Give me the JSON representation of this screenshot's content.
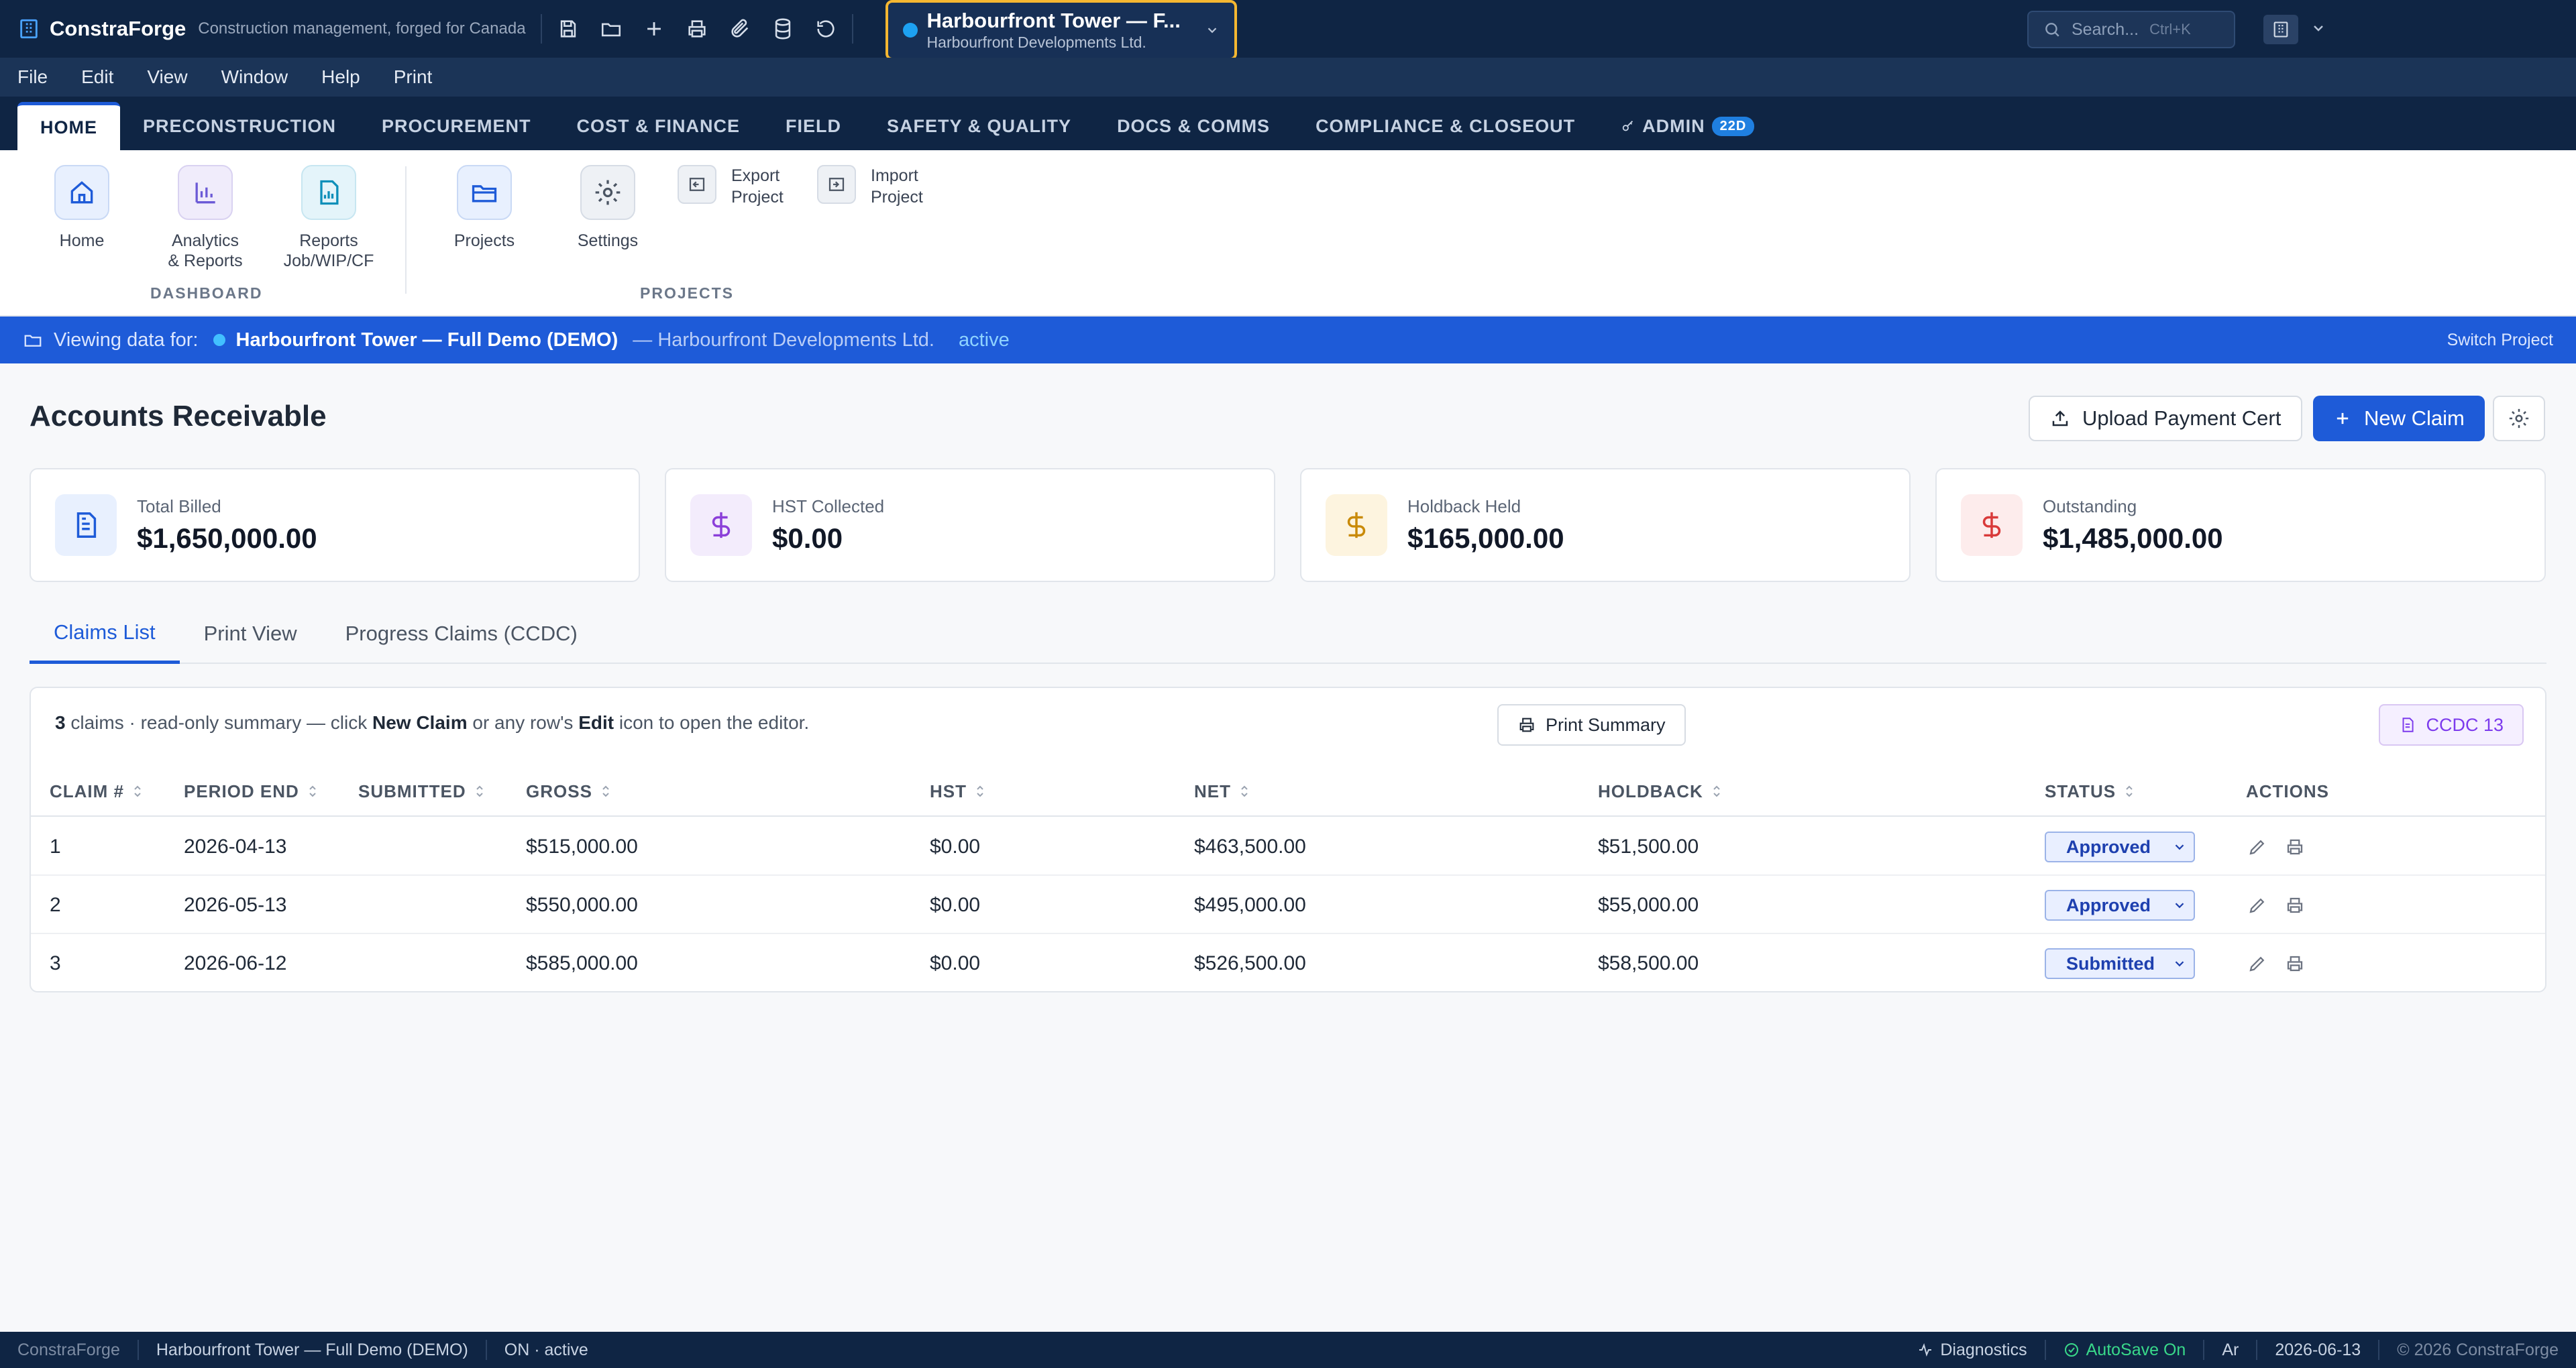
{
  "app": {
    "name": "ConstraForge",
    "tagline": "Construction management, forged for Canada"
  },
  "project_selector": {
    "title": "Harbourfront Tower — F...",
    "client": "Harbourfront Developments Ltd."
  },
  "search": {
    "placeholder": "Search...",
    "shortcut": "Ctrl+K"
  },
  "menu": [
    "File",
    "Edit",
    "View",
    "Window",
    "Help",
    "Print"
  ],
  "ribbon_tabs": [
    {
      "label": "HOME"
    },
    {
      "label": "PRECONSTRUCTION"
    },
    {
      "label": "PROCUREMENT"
    },
    {
      "label": "COST & FINANCE"
    },
    {
      "label": "FIELD"
    },
    {
      "label": "SAFETY & QUALITY"
    },
    {
      "label": "DOCS & COMMS"
    },
    {
      "label": "COMPLIANCE & CLOSEOUT"
    },
    {
      "label": "ADMIN",
      "badge": "22D"
    }
  ],
  "ribbon": {
    "dashboard_label": "DASHBOARD",
    "projects_label": "PROJECTS",
    "home": "Home",
    "analytics_1": "Analytics",
    "analytics_2": "& Reports",
    "reports_1": "Reports",
    "reports_2": "Job/WIP/CF",
    "projects": "Projects",
    "settings": "Settings",
    "export_1": "Export",
    "export_2": "Project",
    "import_1": "Import",
    "import_2": "Project"
  },
  "banner": {
    "prefix": "Viewing data for:",
    "project": "Harbourfront Tower — Full Demo (DEMO)",
    "client": "— Harbourfront Developments Ltd.",
    "status": "active",
    "switch": "Switch Project"
  },
  "page": {
    "title": "Accounts Receivable",
    "upload_label": "Upload Payment Cert",
    "new_claim_label": "New Claim"
  },
  "kpis": [
    {
      "label": "Total Billed",
      "value": "$1,650,000.00",
      "color": "#1e5bd8"
    },
    {
      "label": "HST Collected",
      "value": "$0.00",
      "color": "#8b3fd9"
    },
    {
      "label": "Holdback Held",
      "value": "$165,000.00",
      "color": "#c98a08"
    },
    {
      "label": "Outstanding",
      "value": "$1,485,000.00",
      "color": "#d93a3a"
    }
  ],
  "tabs": [
    {
      "label": "Claims List",
      "active": true
    },
    {
      "label": "Print View",
      "active": false
    },
    {
      "label": "Progress Claims (CCDC)",
      "active": false
    }
  ],
  "summary": {
    "count": "3",
    "text_1": " claims · read-only summary — click ",
    "new_claim": "New Claim",
    "text_2": " or any row's ",
    "edit": "Edit",
    "text_3": " icon to open the editor."
  },
  "print_summary_label": "Print Summary",
  "ccdc_label": "CCDC 13",
  "table": {
    "headers": [
      "CLAIM #",
      "PERIOD END",
      "SUBMITTED",
      "GROSS",
      "HST",
      "NET",
      "HOLDBACK",
      "STATUS",
      "ACTIONS"
    ],
    "rows": [
      {
        "claim": "1",
        "period_end": "2026-04-13",
        "submitted": "",
        "gross": "$515,000.00",
        "hst": "$0.00",
        "net": "$463,500.00",
        "holdback": "$51,500.00",
        "status": "Approved"
      },
      {
        "claim": "2",
        "period_end": "2026-05-13",
        "submitted": "",
        "gross": "$550,000.00",
        "hst": "$0.00",
        "net": "$495,000.00",
        "holdback": "$55,000.00",
        "status": "Approved"
      },
      {
        "claim": "3",
        "period_end": "2026-06-12",
        "submitted": "",
        "gross": "$585,000.00",
        "hst": "$0.00",
        "net": "$526,500.00",
        "holdback": "$58,500.00",
        "status": "Submitted"
      }
    ]
  },
  "statusbar": {
    "app": "ConstraForge",
    "project": "Harbourfront Tower — Full Demo (DEMO)",
    "province": "ON · active",
    "diagnostics": "Diagnostics",
    "autosave": "AutoSave On",
    "lang": "Ar",
    "date": "2026-06-13",
    "copyright": "© 2026 ConstraForge"
  }
}
